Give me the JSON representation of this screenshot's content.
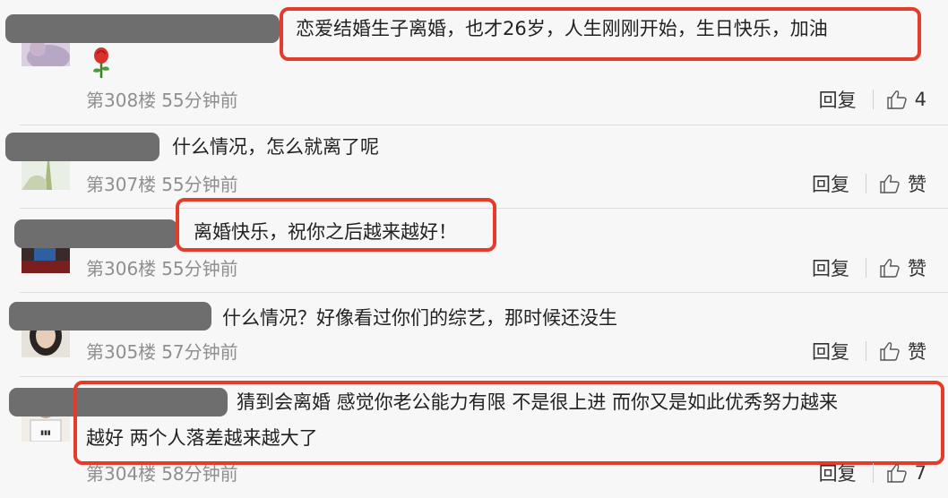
{
  "comments": [
    {
      "text": "恋爱结婚生子离婚，也才26岁，人生刚刚开始，生日快乐，加油",
      "floor": "第308楼",
      "time": "55分钟前",
      "reply_label": "回复",
      "like_label": "4",
      "emoji": "rose-emoji"
    },
    {
      "text": "什么情况，怎么就离了呢",
      "floor": "第307楼",
      "time": "55分钟前",
      "reply_label": "回复",
      "like_label": "赞"
    },
    {
      "text": "离婚快乐，祝你之后越来越好！",
      "floor": "第306楼",
      "time": "55分钟前",
      "reply_label": "回复",
      "like_label": "赞"
    },
    {
      "text": "什么情况？好像看过你们的综艺，那时候还没生",
      "floor": "第305楼",
      "time": "57分钟前",
      "reply_label": "回复",
      "like_label": "赞"
    },
    {
      "text_line1": "猜到会离婚 感觉你老公能力有限 不是很上进 而你又是如此优秀努力越来",
      "text_line2": "越好 两个人落差越来越大了",
      "floor": "第304楼",
      "time": "58分钟前",
      "reply_label": "回复",
      "like_label": "7"
    }
  ],
  "colors": {
    "highlight": "#e53b2a",
    "name_mask": "#6e6e6e",
    "meta": "#8f8f8f",
    "background": "#f7f7f7"
  }
}
